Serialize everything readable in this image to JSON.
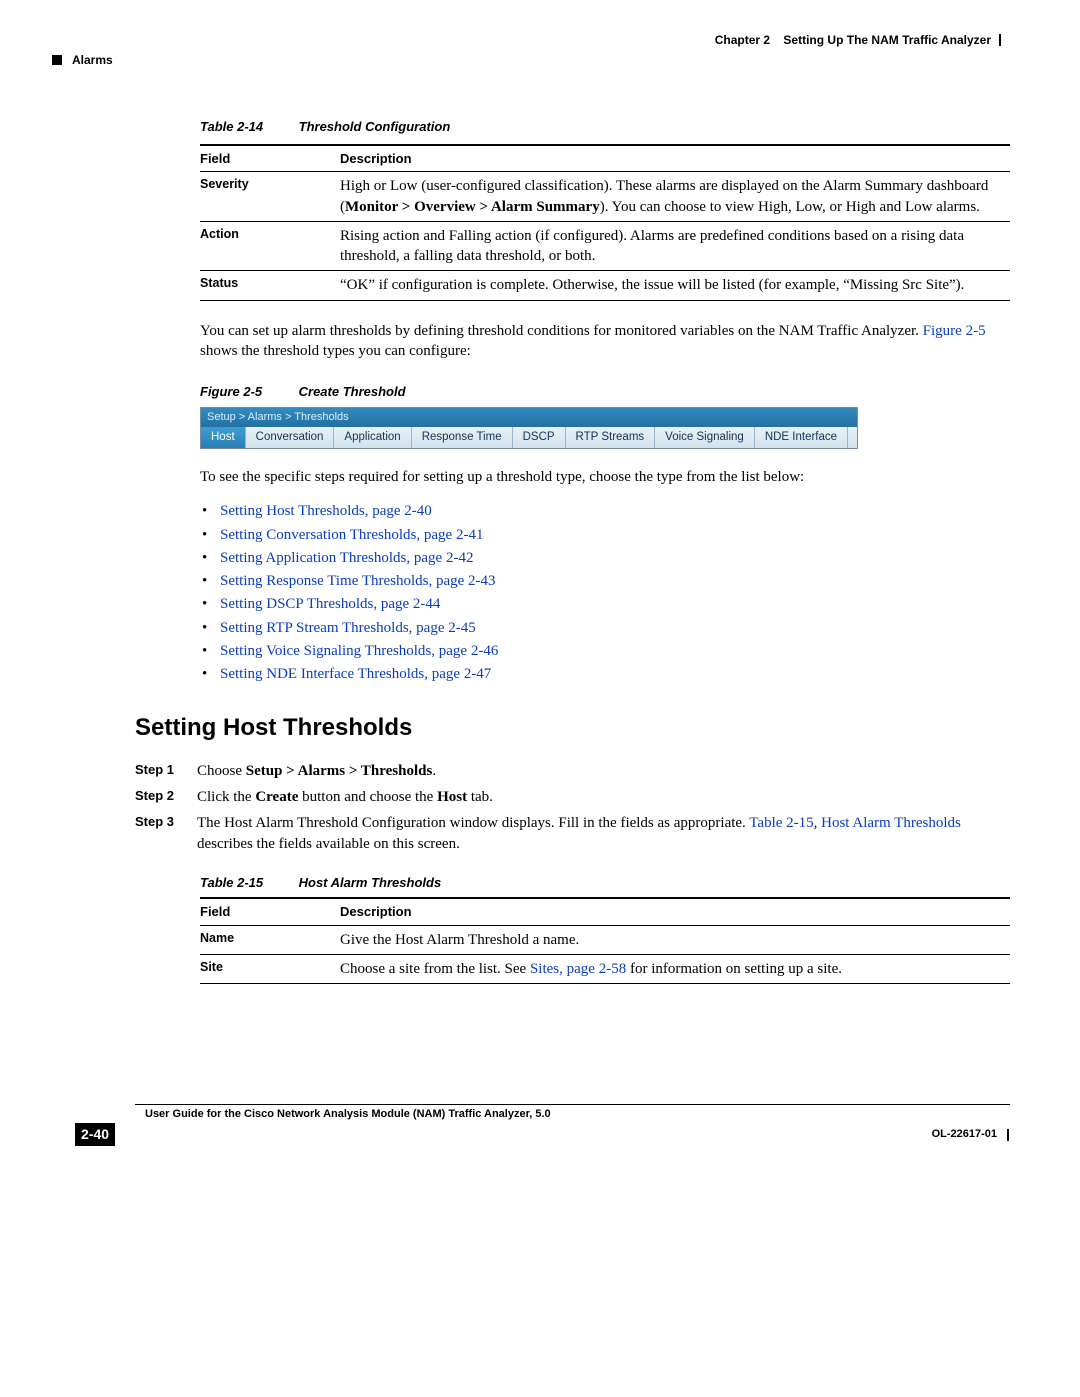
{
  "header": {
    "chapter": "Chapter 2",
    "chapter_title": "Setting Up The NAM Traffic Analyzer",
    "section": "Alarms"
  },
  "table214": {
    "caption_label": "Table 2-14",
    "caption_title": "Threshold Configuration",
    "col_field": "Field",
    "col_desc": "Description",
    "rows": {
      "severity": {
        "field": "Severity",
        "desc_pre": "High or Low (user-configured classification). These alarms are displayed on the Alarm Summary dashboard (",
        "desc_bold": "Monitor > Overview > Alarm Summary",
        "desc_post": "). You can choose to view High, Low, or High and Low alarms."
      },
      "action": {
        "field": "Action",
        "desc": "Rising action and Falling action (if configured). Alarms are predefined conditions based on a rising data threshold, a falling data threshold, or both."
      },
      "status": {
        "field": "Status",
        "desc": "“OK” if configuration is complete. Otherwise, the issue will be listed (for example, “Missing Src Site”)."
      }
    }
  },
  "para1_a": "You can set up alarm thresholds by defining threshold conditions for monitored variables on the NAM Traffic Analyzer. ",
  "para1_link": "Figure 2-5",
  "para1_b": " shows the threshold types you can configure:",
  "figure25": {
    "caption_label": "Figure 2-5",
    "caption_title": "Create Threshold",
    "breadcrumb": "Setup > Alarms > Thresholds",
    "tabs": [
      "Host",
      "Conversation",
      "Application",
      "Response Time",
      "DSCP",
      "RTP Streams",
      "Voice Signaling",
      "NDE Interface"
    ]
  },
  "para2": "To see the specific steps required for setting up a threshold type, choose the type from the list below:",
  "link_list": [
    "Setting Host Thresholds, page 2-40",
    "Setting Conversation Thresholds, page 2-41",
    "Setting Application Thresholds, page 2-42",
    "Setting Response Time Thresholds, page 2-43",
    "Setting DSCP Thresholds, page 2-44",
    "Setting RTP Stream Thresholds, page 2-45",
    "Setting Voice Signaling Thresholds, page 2-46",
    "Setting NDE Interface Thresholds, page 2-47"
  ],
  "section_heading": "Setting Host Thresholds",
  "steps": {
    "s1": {
      "label": "Step 1",
      "pre": "Choose ",
      "bold": "Setup > Alarms > Thresholds",
      "post": "."
    },
    "s2": {
      "label": "Step 2",
      "pre": "Click the ",
      "b1": "Create",
      "mid": " button and choose the ",
      "b2": "Host",
      "post": " tab."
    },
    "s3": {
      "label": "Step 3",
      "pre": "The Host Alarm Threshold Configuration window displays. Fill in the fields as appropriate. ",
      "link1": "Table 2-15",
      "mid": ", ",
      "link2": "Host Alarm Thresholds",
      "post": " describes the fields available on this screen."
    }
  },
  "table215": {
    "caption_label": "Table 2-15",
    "caption_title": "Host Alarm Thresholds",
    "col_field": "Field",
    "col_desc": "Description",
    "rows": {
      "name": {
        "field": "Name",
        "desc": "Give the Host Alarm Threshold a name."
      },
      "site": {
        "field": "Site",
        "desc_pre": "Choose a site from the list. See ",
        "desc_link": "Sites, page 2-58",
        "desc_post": " for information on setting up a site."
      }
    }
  },
  "footer": {
    "guide": "User Guide for the Cisco Network Analysis Module (NAM) Traffic Analyzer, 5.0",
    "page": "2-40",
    "ol": "OL-22617-01"
  }
}
